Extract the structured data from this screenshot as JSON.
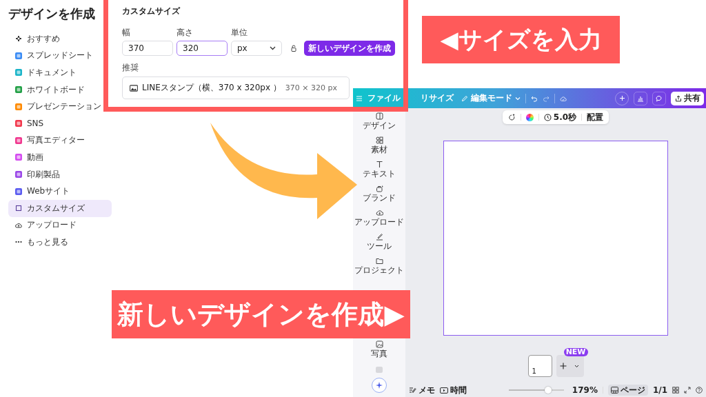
{
  "sidebar": {
    "title": "デザインを作成",
    "items": [
      {
        "label": "おすすめ",
        "kind": "sparkle",
        "selected": false
      },
      {
        "label": "スプレッドシート",
        "kind": "tile",
        "color": "#3b8cf5",
        "selected": false
      },
      {
        "label": "ドキュメント",
        "kind": "tile",
        "color": "#1cb5c9",
        "selected": false
      },
      {
        "label": "ホワイトボード",
        "kind": "tile",
        "color": "#23a047",
        "selected": false
      },
      {
        "label": "プレゼンテーション",
        "kind": "tile",
        "color": "#ff8a00",
        "selected": false
      },
      {
        "label": "SNS",
        "kind": "tile",
        "color": "#f2394d",
        "selected": false
      },
      {
        "label": "写真エディター",
        "kind": "tile",
        "color": "#f0388f",
        "selected": false
      },
      {
        "label": "動画",
        "kind": "tile",
        "color": "#d44df0",
        "selected": false
      },
      {
        "label": "印刷製品",
        "kind": "tile",
        "color": "#9b48e8",
        "selected": false
      },
      {
        "label": "Webサイト",
        "kind": "tile",
        "color": "#5b5cf0",
        "selected": false
      },
      {
        "label": "カスタムサイズ",
        "kind": "frame",
        "selected": true
      },
      {
        "label": "アップロード",
        "kind": "cloud",
        "selected": false
      },
      {
        "label": "もっと見る",
        "kind": "dots",
        "selected": false
      }
    ]
  },
  "dialog": {
    "title": "カスタムサイズ",
    "fields": [
      {
        "label": "幅",
        "value": "370",
        "focused": false
      },
      {
        "label": "高さ",
        "value": "320",
        "focused": true
      }
    ],
    "unit": {
      "label": "単位",
      "value": "px"
    },
    "create_button": "新しいデザインを作成",
    "suggestion_label": "推奨",
    "suggestion": {
      "name": "LINEスタンプ（横、370 x 320px ）",
      "size": "370 × 320 px"
    }
  },
  "editor": {
    "toolbar": {
      "file": "ファイル",
      "resize": "リサイズ",
      "mode": "編集モード",
      "share": "共有"
    },
    "floating_toolbar": {
      "duration": "5.0秒",
      "position": "配置"
    },
    "rail": [
      "デザイン",
      "素材",
      "テキスト",
      "ブランド",
      "アップロード",
      "ツール",
      "プロジェクト",
      "写真"
    ],
    "page_number": "1",
    "new_badge": "NEW",
    "status_bar": {
      "notes": "メモ",
      "timer": "時間",
      "zoom_slider": {
        "level": 0.72
      },
      "zoom": "179%",
      "pages": "ページ",
      "page_count": "1/1"
    }
  },
  "callouts": [
    {
      "text": "◀サイズを入力"
    },
    {
      "text": "新しいデザインを作成▶"
    }
  ]
}
